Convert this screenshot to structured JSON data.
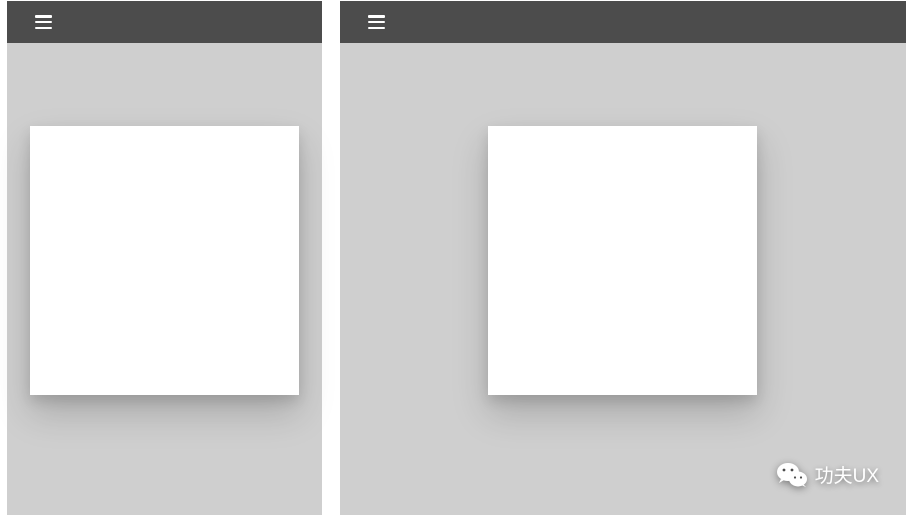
{
  "frames": {
    "left": {
      "menu_icon": "hamburger-icon"
    },
    "right": {
      "menu_icon": "hamburger-icon"
    }
  },
  "watermark": {
    "icon": "wechat-icon",
    "label": "功夫UX"
  }
}
